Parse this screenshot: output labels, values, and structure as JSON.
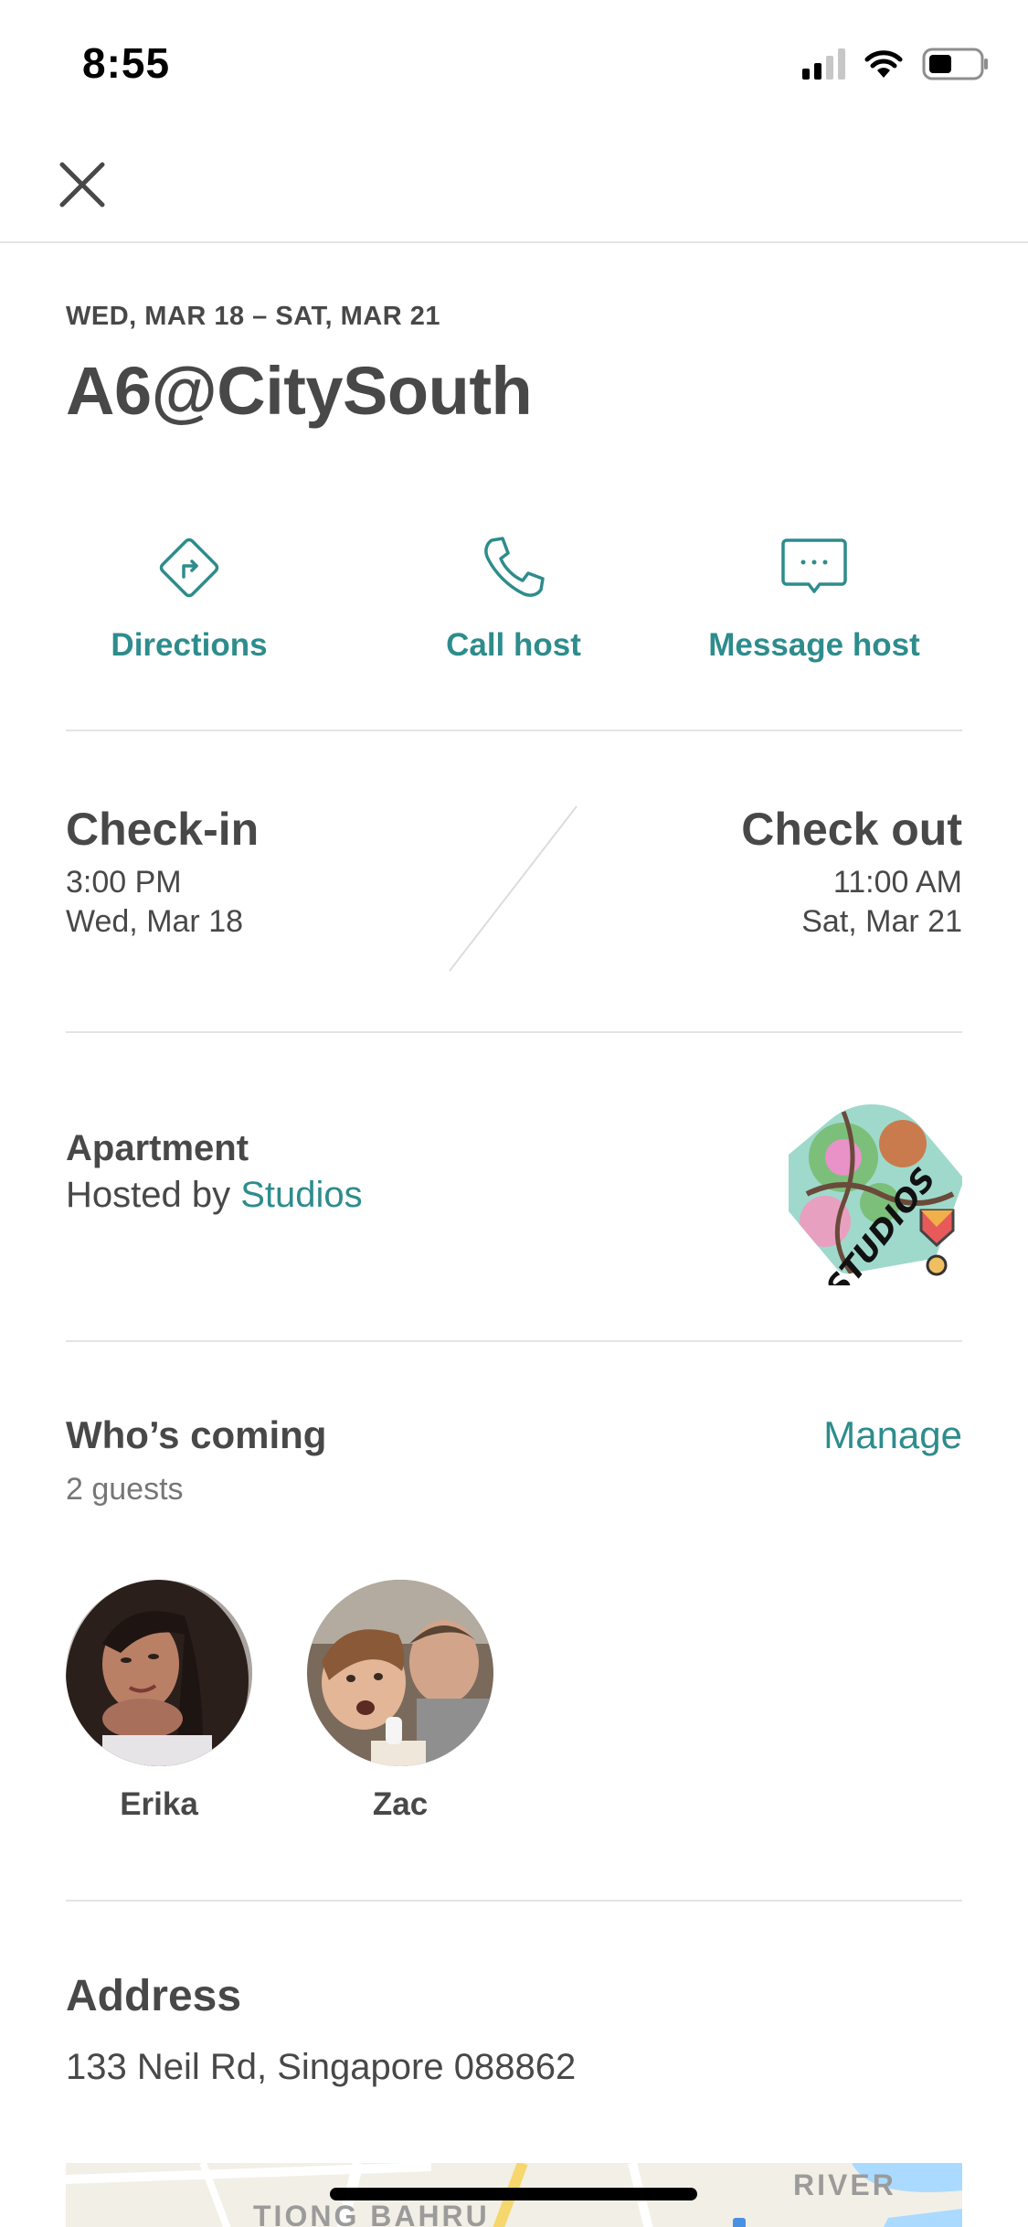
{
  "status_bar": {
    "time": "8:55"
  },
  "header": {
    "close_icon": "close-icon"
  },
  "reservation": {
    "dates": "WED, MAR 18 – SAT, MAR 21",
    "title": "A6@CitySouth"
  },
  "actions": [
    {
      "label": "Directions",
      "icon": "directions-icon"
    },
    {
      "label": "Call host",
      "icon": "phone-icon"
    },
    {
      "label": "Message host",
      "icon": "message-icon"
    }
  ],
  "checkin": {
    "heading": "Check-in",
    "time": "3:00 PM",
    "date": "Wed, Mar 18"
  },
  "checkout": {
    "heading": "Check out",
    "time": "11:00 AM",
    "date": "Sat, Mar 21"
  },
  "listing": {
    "type": "Apartment",
    "hosted_prefix": "Hosted by ",
    "host_name": "Studios",
    "logo_text": "STUDIOS"
  },
  "guests": {
    "title": "Who’s coming",
    "count": "2 guests",
    "manage_label": "Manage",
    "people": [
      {
        "name": "Erika"
      },
      {
        "name": "Zac"
      }
    ]
  },
  "address": {
    "title": "Address",
    "text": "133 Neil Rd, Singapore 088862"
  },
  "map": {
    "labels": [
      "TIONG BAHRU",
      "RIVER"
    ]
  },
  "colors": {
    "accent": "#2e8c8c",
    "text": "#484848",
    "muted": "#767676",
    "divider": "#e4e4e4"
  }
}
